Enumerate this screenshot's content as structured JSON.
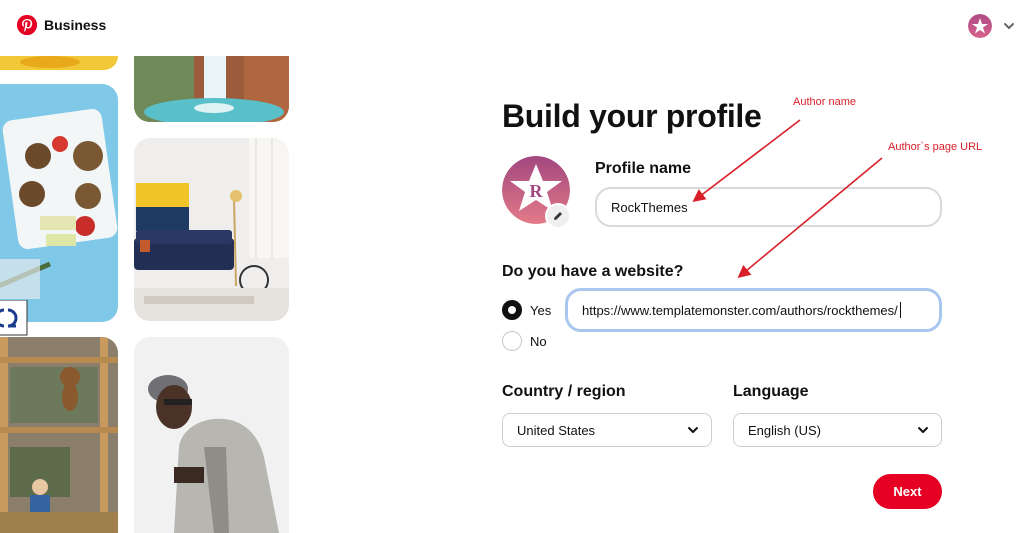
{
  "header": {
    "brand": "Business",
    "brand_color": "#e60023",
    "logo_icon": "pinterest-logo",
    "account_icon": "avatar-icon",
    "menu_icon": "chevron-down-icon"
  },
  "form": {
    "title": "Build your profile",
    "profile_name_label": "Profile name",
    "profile_name_value": "RockThemes",
    "website_label": "Do you have a website?",
    "website_options": [
      {
        "label": "Yes",
        "selected": true
      },
      {
        "label": "No",
        "selected": false
      }
    ],
    "website_value": "https://www.templatemonster.com/authors/rockthemes/",
    "country_label": "Country / region",
    "country_value": "United States",
    "language_label": "Language",
    "language_value": "English (US)",
    "next_label": "Next",
    "accent_color": "#e60023"
  },
  "annotations": {
    "author_name": "Author name",
    "author_url": "Author`s page URL",
    "color": "#d9202a"
  }
}
